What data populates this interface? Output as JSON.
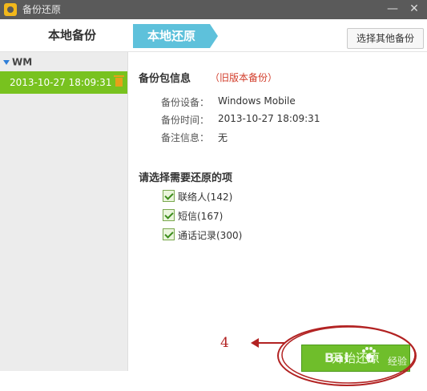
{
  "window": {
    "title": "备份还原",
    "minimize_glyph": "—",
    "close_glyph": "✕"
  },
  "tabs": {
    "backup_label": "本地备份",
    "restore_label": "本地还原",
    "other_backup_button": "选择其他备份"
  },
  "sidebar": {
    "group_label": "WM",
    "items": [
      {
        "label": "2013-10-27 18:09:31"
      }
    ]
  },
  "info": {
    "title": "备份包信息",
    "old_version_tag": "（旧版本备份）",
    "device_label": "备份设备：",
    "device_value": "Windows Mobile",
    "time_label": "备份时间：",
    "time_value": "2013-10-27 18:09:31",
    "note_label": "备注信息：",
    "note_value": "无"
  },
  "restore_select": {
    "title": "请选择需要还原的项",
    "items": [
      {
        "label": "联络人(142)",
        "checked": true
      },
      {
        "label": "短信(167)",
        "checked": true
      },
      {
        "label": "通话记录(300)",
        "checked": true
      }
    ]
  },
  "start_button": {
    "label": "开始还原"
  },
  "annotation": {
    "step_number": "4"
  },
  "watermark": {
    "text": "Bai",
    "text_tail": "u",
    "subtext": "经验"
  },
  "colors": {
    "titlebar": "#5a5a5a",
    "tab_accent": "#5ec1db",
    "selected_item": "#78c21f",
    "start_button": "#6fbe2b",
    "old_tag_red": "#d23c2a",
    "annotation_red": "#b22222"
  }
}
